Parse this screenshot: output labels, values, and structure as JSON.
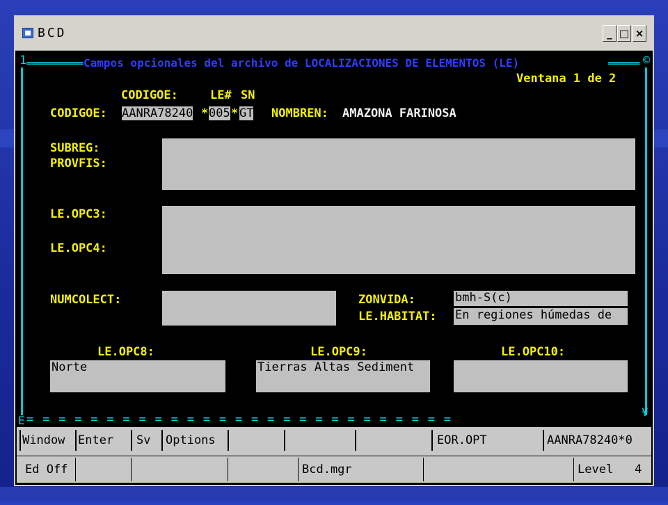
{
  "window": {
    "title": "BCD",
    "min": "_",
    "max": "□",
    "close": "×"
  },
  "screen": {
    "frame_title": "Campos opcionales del archivo de LOCALIZACIONES DE ELEMENTOS (LE)",
    "frame_left_mark": "1",
    "frame_right_mark": "©",
    "ventana": "Ventana 1 de 2",
    "header_codigoe": "CODIGOE:",
    "header_le": "LE#",
    "header_sn": "SN",
    "codigoe_label": "CODIGOE:",
    "codigoe_value": "AANRA78240",
    "codigoe_star1": "*",
    "le_value": "005",
    "codigoe_star2": "*",
    "sn_value": "GT",
    "nombren_label": "NOMBREN:",
    "nombren_value": "AMAZONA FARINOSA",
    "subreg_label": "SUBREG:",
    "provfis_label": "PROVFIS:",
    "leopc3_label": "LE.OPC3:",
    "leopc4_label": "LE.OPC4:",
    "numcolect_label": "NUMCOLECT:",
    "zonvida_label": "ZONVIDA:",
    "zonvida_value": "bmh-S(c)",
    "lehabitat_label": "LE.HABITAT:",
    "lehabitat_value": "En regiones húmedas de",
    "leopc8_label": "LE.OPC8:",
    "leopc8_value": "Norte",
    "leopc9_label": "LE.OPC9:",
    "leopc9_value": "Tierras Altas Sediment",
    "leopc10_label": "LE.OPC10:",
    "bottom_rule": "= = = = = = = = = = = = = = = = = = = = = = = = = = =",
    "bottom_left_mark": "E",
    "bottom_right_mark": "¥"
  },
  "function_keys": [
    "Window",
    "Enter",
    "Sv",
    "Options",
    "",
    "",
    "EOR.OPT",
    "AANRA78240*0"
  ],
  "status": {
    "mode": "Ed Off",
    "file": "Bcd.mgr",
    "level_label": "Level",
    "level_value": "4"
  }
}
